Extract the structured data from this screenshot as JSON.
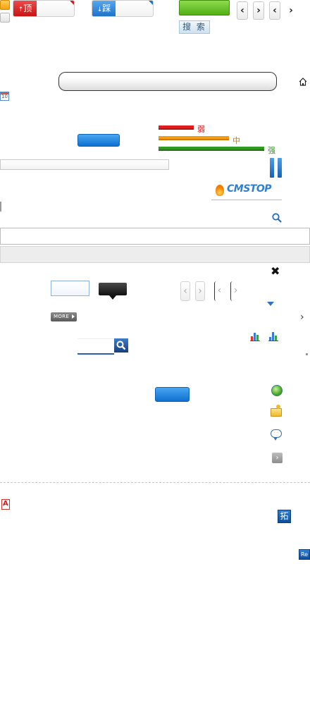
{
  "vote": {
    "ding_label": "顶",
    "cai_label": "踩"
  },
  "search_button_label": "搜 索",
  "arrows": {
    "prev": "‹",
    "next": "›"
  },
  "calendar_icon_text": "10",
  "strength": {
    "weak": "弱",
    "medium": "中",
    "strong": "强"
  },
  "logo_text": "CMSTOP",
  "more_label": "MORE",
  "close_symbol": "✖",
  "chevron": "›",
  "tuo_label": "拓",
  "re_label": "Re",
  "colors": {
    "accent_blue": "#0d6fd1",
    "vote_red": "#d11b1b",
    "vote_blue": "#1f72c9",
    "green": "#4fae12",
    "weak_red": "#e01e1e",
    "medium_orange": "#f39c12",
    "strong_green": "#2e9a1e"
  },
  "icons": [
    "orange-square-icon",
    "gray-square-icon",
    "home-icon",
    "calendar-icon",
    "pause-icon",
    "search-icon",
    "close-icon",
    "dropdown-triangle-icon",
    "bar-chart-icon",
    "globe-icon",
    "folder-star-icon",
    "chat-icon",
    "next-icon",
    "pdf-icon"
  ]
}
